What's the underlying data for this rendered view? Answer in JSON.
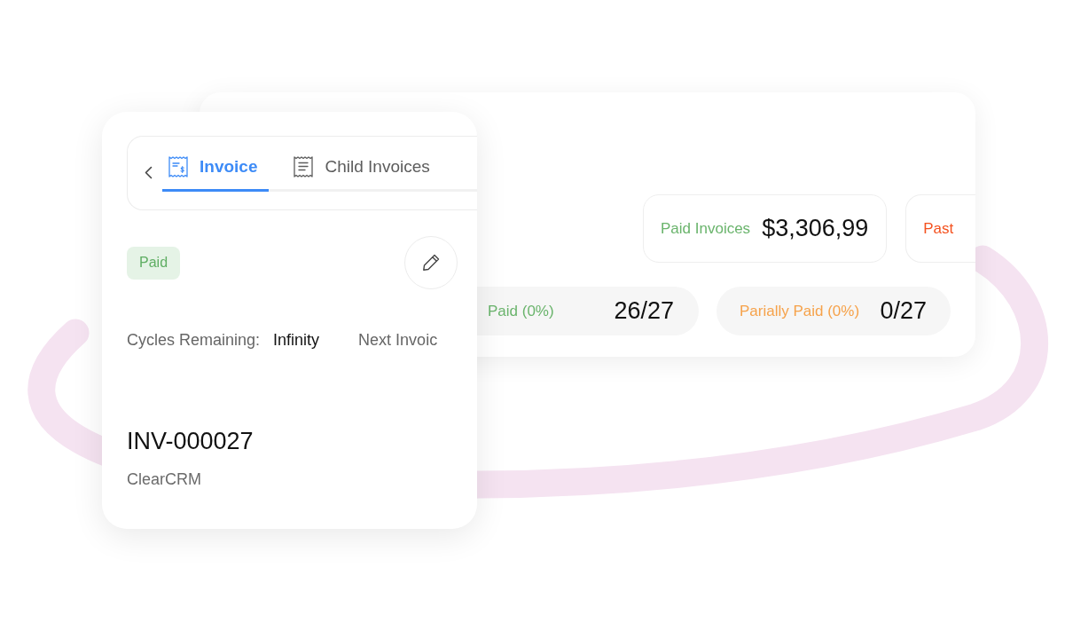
{
  "invoice_card": {
    "tabs": [
      {
        "label": "Invoice",
        "selected": true
      },
      {
        "label": "Child Invoices",
        "selected": false
      }
    ],
    "status_badge": "Paid",
    "details": [
      {
        "label": "Cycles Remaining:",
        "value": "Infinity"
      },
      {
        "label": "Next Invoic"
      }
    ],
    "invoice_number": "INV-000027",
    "company": "ClearCRM"
  },
  "summary_card": {
    "totals": [
      {
        "label": "Paid Invoices",
        "value": "$3,306,99",
        "color": "#6ab46c"
      },
      {
        "label": "Past",
        "color": "#f4511e"
      }
    ],
    "status_counts": [
      {
        "label": "Paid (0%)",
        "value": "26/27",
        "color": "#6ab46c"
      },
      {
        "label": "Parially Paid (0%)",
        "value": "0/27",
        "color": "#f6a24a"
      }
    ]
  }
}
